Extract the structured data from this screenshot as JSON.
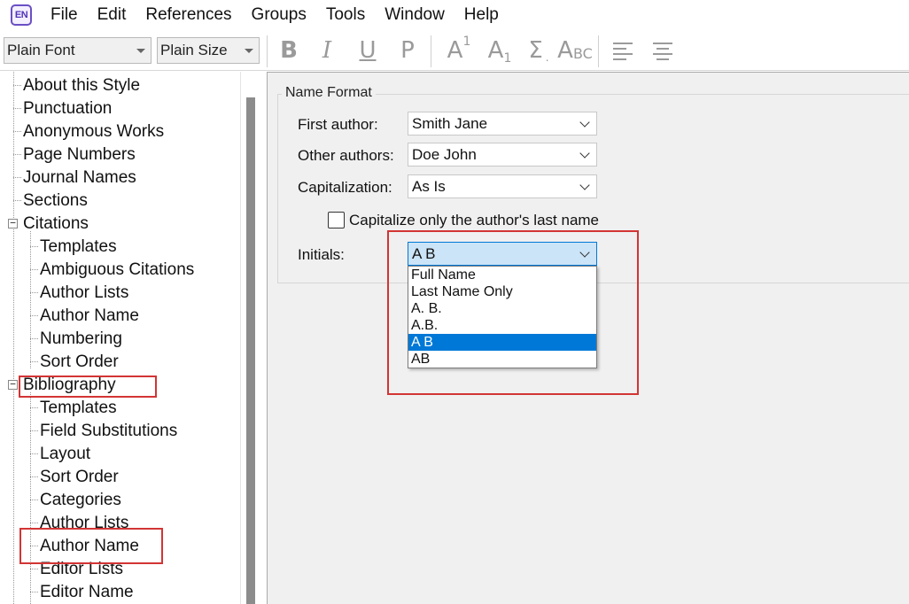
{
  "app": {
    "logo_text": "EN"
  },
  "menu": [
    "File",
    "Edit",
    "References",
    "Groups",
    "Tools",
    "Window",
    "Help"
  ],
  "toolbar": {
    "font_combo": "Plain Font",
    "size_combo": "Plain Size",
    "bold": "B",
    "italic": "I",
    "underline": "U",
    "plain": "P",
    "superscript_base": "A",
    "superscript_mark": "1",
    "subscript_base": "A",
    "subscript_mark": "1",
    "symbol": "Σ",
    "smallcaps_big": "A",
    "smallcaps_small": "BC"
  },
  "tree": {
    "items": [
      "About this Style",
      "Punctuation",
      "Anonymous Works",
      "Page Numbers",
      "Journal Names",
      "Sections",
      "Citations",
      "Templates",
      "Ambiguous Citations",
      "Author Lists",
      "Author Name",
      "Numbering",
      "Sort Order",
      "Bibliography",
      "Templates",
      "Field Substitutions",
      "Layout",
      "Sort Order",
      "Categories",
      "Author Lists",
      "Author Name",
      "Editor Lists",
      "Editor Name"
    ]
  },
  "name_format": {
    "title": "Name Format",
    "first_author_label": "First author:",
    "first_author_value": "Smith Jane",
    "other_authors_label": "Other authors:",
    "other_authors_value": "Doe John",
    "capitalization_label": "Capitalization:",
    "capitalization_value": "As Is",
    "capitalize_checkbox_label": "Capitalize only the author's last name",
    "initials_label": "Initials:",
    "initials_value": "A B",
    "initials_options": [
      "Full Name",
      "Last Name Only",
      "A. B.",
      "A.B.",
      "A B",
      "AB"
    ],
    "initials_selected_index": 4
  },
  "colors": {
    "highlight_box": "#d33434",
    "selection": "#0078d7",
    "open_select_bg": "#cce4f7"
  }
}
